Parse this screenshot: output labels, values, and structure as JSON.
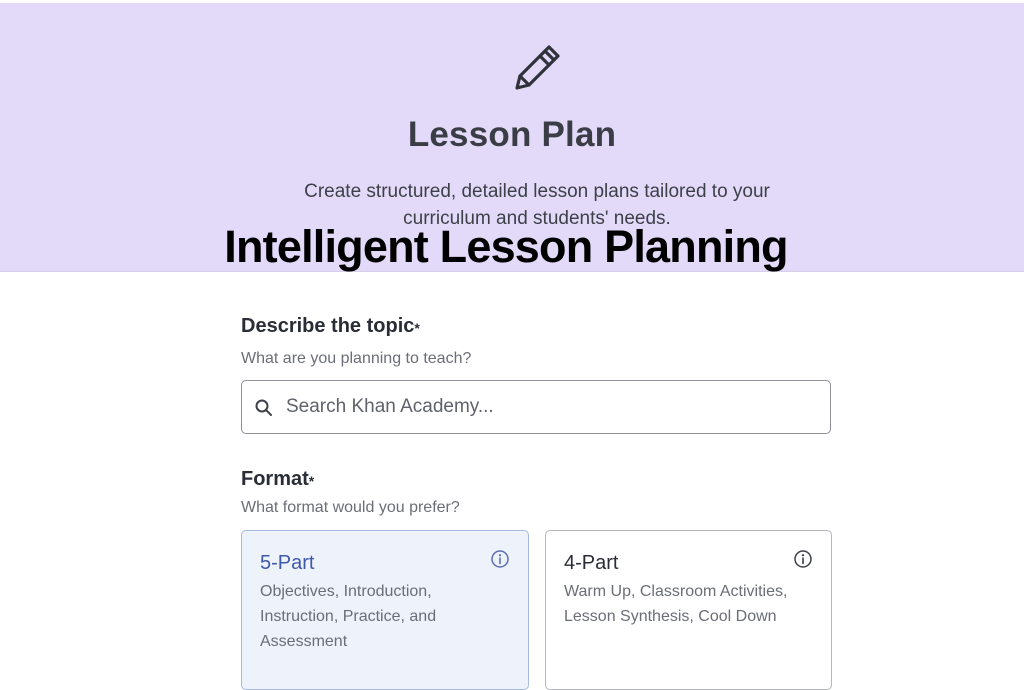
{
  "header": {
    "title": "Lesson Plan",
    "subtitle": "Create structured, detailed lesson plans tailored to your curriculum and students' needs.",
    "icon": "pencil-icon",
    "background": "#e3daf9"
  },
  "overlay": {
    "caption": "Intelligent Lesson Planning"
  },
  "form": {
    "topic": {
      "label": "Describe the topic",
      "required_marker": "*",
      "hint": "What are you planning to teach?",
      "search_placeholder": "Search Khan Academy...",
      "search_value": "",
      "icon": "search-icon"
    },
    "format": {
      "label": "Format",
      "required_marker": "*",
      "hint": "What format would you prefer?",
      "options": [
        {
          "title": "5-Part",
          "description": "Objectives, Introduction, Instruction, Practice, and Assessment",
          "selected": true,
          "icon": "info-icon"
        },
        {
          "title": "4-Part",
          "description": "Warm Up, Classroom Activities, Lesson Synthesis, Cool Down",
          "selected": false,
          "icon": "info-icon"
        }
      ]
    }
  },
  "colors": {
    "accent": "#3e59a8",
    "selected_card_bg": "#eef2fb"
  }
}
